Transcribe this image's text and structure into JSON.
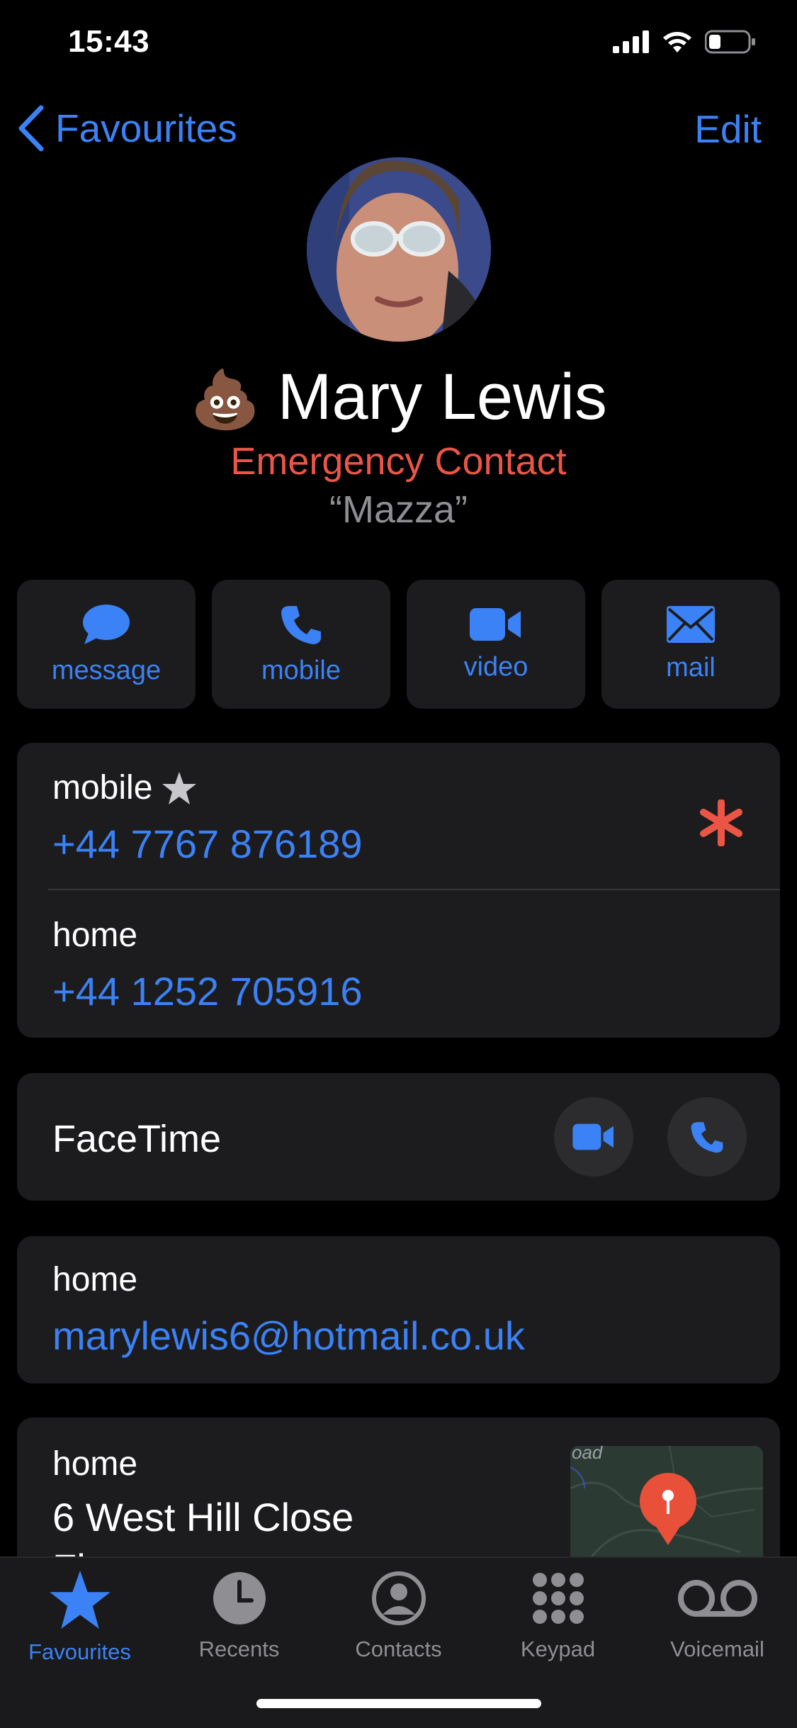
{
  "status": {
    "time": "15:43"
  },
  "nav": {
    "back_label": "Favourites",
    "edit_label": "Edit"
  },
  "contact": {
    "emoji": "💩",
    "name": "Mary Lewis",
    "subtitle": "Emergency Contact",
    "nickname": "“Mazza”"
  },
  "actions": [
    {
      "label": "message",
      "icon": "message-bubble-icon"
    },
    {
      "label": "mobile",
      "icon": "phone-icon"
    },
    {
      "label": "video",
      "icon": "video-camera-icon"
    },
    {
      "label": "mail",
      "icon": "envelope-icon"
    }
  ],
  "phones": [
    {
      "label": "mobile",
      "value": "+44 7767 876189",
      "favourite": true,
      "emergency": true
    },
    {
      "label": "home",
      "value": "+44 1252 705916"
    }
  ],
  "facetime": {
    "label": "FaceTime"
  },
  "email": {
    "label": "home",
    "value": "marylewis6@hotmail.co.uk"
  },
  "address": {
    "label": "home",
    "line1": "6 West Hill Close",
    "line2": "Fleet...",
    "map_text": "oad"
  },
  "tabs": [
    {
      "label": "Favourites",
      "icon": "star-icon",
      "active": true
    },
    {
      "label": "Recents",
      "icon": "clock-icon"
    },
    {
      "label": "Contacts",
      "icon": "person-circle-icon"
    },
    {
      "label": "Keypad",
      "icon": "keypad-icon"
    },
    {
      "label": "Voicemail",
      "icon": "voicemail-icon"
    }
  ],
  "colors": {
    "accent": "#3b82f6",
    "emergency": "#eb5545",
    "card": "#1c1c1e",
    "background": "#000000"
  }
}
